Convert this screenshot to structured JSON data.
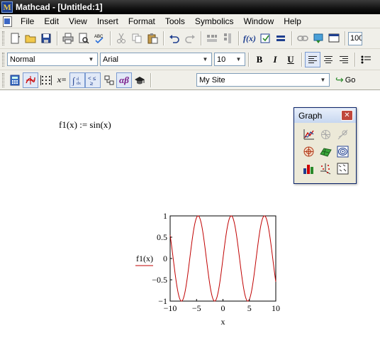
{
  "titlebar": {
    "app_icon": "M",
    "title": "Mathcad - [Untitled:1]"
  },
  "menu": [
    "File",
    "Edit",
    "View",
    "Insert",
    "Format",
    "Tools",
    "Symbolics",
    "Window",
    "Help"
  ],
  "toolbar_standard": {
    "zoom_value": "100"
  },
  "toolbar_format": {
    "style": "Normal",
    "font": "Arial",
    "size": "10",
    "bold": "B",
    "italic": "I",
    "underline": "U"
  },
  "toolbar_math": {
    "calculator": "calculator-icon",
    "graph": "graph-toolbar-icon",
    "matrix": "matrix-icon",
    "evaluation": "x=",
    "calculus": "calculus-icon",
    "boolean": "boolean-icon",
    "programming": "programming-icon",
    "greek": "αβ",
    "symbolic": "symbolic-icon",
    "site": "My Site",
    "go_label": "Go"
  },
  "worksheet": {
    "equation": "f1(x) := sin(x)"
  },
  "graph_palette": {
    "title": "Graph",
    "buttons": [
      "xy-plot-icon",
      "polar-plot-icon",
      "zoom-icon",
      "polar-target-icon",
      "surface-plot-icon",
      "contour-plot-icon",
      "bar-3d-icon",
      "scatter-3d-icon",
      "vector-field-icon"
    ]
  },
  "chart_data": {
    "type": "line",
    "xlabel": "x",
    "ylabel": "f1(x)",
    "xlim": [
      -10,
      10
    ],
    "ylim": [
      -1,
      1
    ],
    "xticks": [
      "−10",
      "−5",
      "0",
      "5",
      "10"
    ],
    "yticks": [
      "1",
      "0.5",
      "0",
      "−0.5",
      "−1"
    ],
    "series": [
      {
        "function": "sin(x)",
        "color": "#c00000"
      }
    ]
  }
}
